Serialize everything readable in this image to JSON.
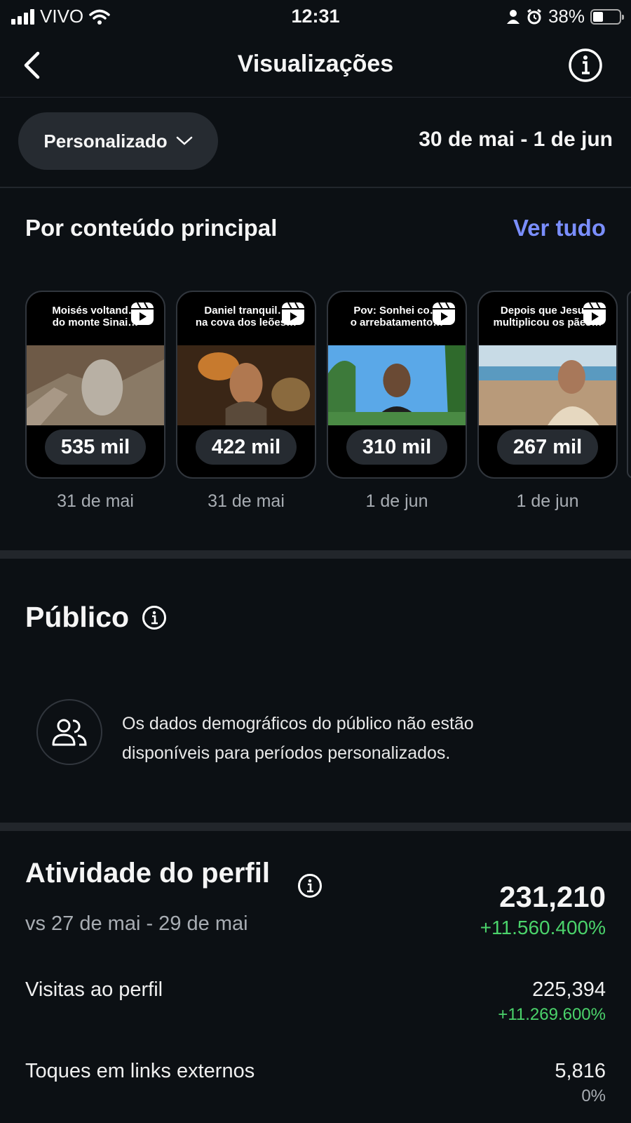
{
  "status_bar": {
    "carrier": "VIVO",
    "time": "12:31",
    "battery": "38%",
    "battery_level": 0.38
  },
  "nav": {
    "title": "Visualizações",
    "back_icon": "chevron-left-icon",
    "info_icon": "info-icon"
  },
  "filter": {
    "period_label": "Personalizado",
    "date_range": "30 de mai - 1 de jun"
  },
  "top_content": {
    "title": "Por conteúdo principal",
    "see_all": "Ver tudo",
    "items": [
      {
        "caption": "Moisés voltand…\ndo monte Sinai…",
        "views": "535 mil",
        "date": "31 de mai"
      },
      {
        "caption": "Daniel tranquil…\nna cova dos leões…",
        "views": "422 mil",
        "date": "31 de mai"
      },
      {
        "caption": "Pov: Sonhei co…\no arrebatamento…",
        "views": "310 mil",
        "date": "1 de jun"
      },
      {
        "caption": "Depois que Jesu…\nmultiplicou os pães…",
        "views": "267 mil",
        "date": "1 de jun"
      }
    ]
  },
  "audience": {
    "title": "Público",
    "message": "Os dados demográficos do público não estão disponíveis para períodos personalizados."
  },
  "profile_activity": {
    "title": "Atividade do perfil",
    "comparison": "vs 27 de mai - 29 de mai",
    "total": "231,210",
    "total_change": "+11.560.400%",
    "metrics": [
      {
        "label": "Visitas ao perfil",
        "value": "225,394",
        "change": "+11.269.600%"
      },
      {
        "label": "Toques em links externos",
        "value": "5,816",
        "change": "0%"
      }
    ]
  },
  "colors": {
    "background": "#0c1014",
    "accent_link": "#7a8eff",
    "positive": "#4bd36b",
    "neutral": "#a8adb3"
  }
}
